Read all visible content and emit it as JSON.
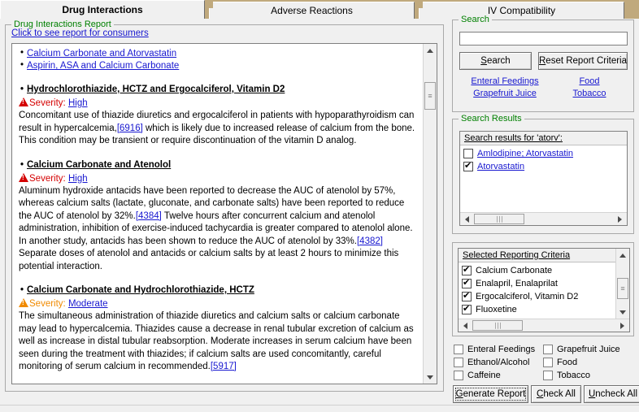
{
  "window": {
    "title": "Drug Interactions"
  },
  "tabs": [
    {
      "label": "Drug Interactions",
      "active": true
    },
    {
      "label": "Adverse Reactions",
      "active": false
    },
    {
      "label": "IV Compatibility",
      "active": false
    }
  ],
  "report_panel": {
    "group_label": "Drug Interactions Report",
    "consumer_link": "Click to see report for consumers",
    "quick_links": [
      "Calcium Carbonate and Atorvastatin",
      "Aspirin, ASA and Calcium Carbonate"
    ],
    "interactions": [
      {
        "title": "Hydrochlorothiazide, HCTZ and Ergocalciferol, Vitamin D2",
        "severity_label": "Severity:",
        "severity_value": "High",
        "severity_level": "high",
        "body_part1": "Concomitant use of thiazide diuretics and ergocalciferol in patients with hypoparathyroidism can result in hypercalcemia,",
        "citation1": "[6916]",
        "body_part2": " which is likely due to increased release of calcium from the bone. This condition may be transient or require discontinuation of the vitamin D analog."
      },
      {
        "title": "Calcium Carbonate and Atenolol",
        "severity_label": "Severity:",
        "severity_value": "High",
        "severity_level": "high",
        "body_part1": "Aluminum hydroxide antacids have been reported to decrease the AUC of atenolol by 57%, whereas calcium salts (lactate, gluconate, and carbonate salts) have been reported to reduce the AUC of atenolol by 32%.",
        "citation1": "[4384]",
        "body_part2": " Twelve hours after concurrent calcium and atenolol administration, inhibition of exercise-induced tachycardia is greater compared to atenolol alone. In another study, antacids has been shown to reduce the AUC of atenolol by 33%.",
        "citation2": "[4382]",
        "body_part3": " Separate doses of atenolol and antacids or calcium salts by at least 2 hours to minimize this potential interaction."
      },
      {
        "title": "Calcium Carbonate and Hydrochlorothiazide, HCTZ",
        "severity_label": "Severity:",
        "severity_value": "Moderate",
        "severity_level": "moderate",
        "body_part1": "The simultaneous administration of thiazide diuretics and calcium salts or calcium carbonate may lead to hypercalcemia. Thiazides cause a decrease in renal tubular excretion of calcium as well as increase in distal tubular reabsorption. Moderate increases in serum calcium have been seen during the treatment with thiazides; if calcium salts are used concomitantly, careful monitoring of serum calcium in recommended.",
        "citation1": "[5917]",
        "body_part2": ""
      }
    ]
  },
  "search_panel": {
    "group_label": "Search",
    "input_value": "",
    "input_placeholder": "",
    "search_button": "Search",
    "search_button_accel": "S",
    "reset_button": "Reset Report Criteria",
    "reset_button_accel": "R",
    "quick_links_row1": [
      "Enteral Feedings",
      "Food"
    ],
    "quick_links_row2": [
      "Grapefruit Juice",
      "Tobacco"
    ]
  },
  "search_results_panel": {
    "group_label": "Search Results",
    "list_header": "Search results for 'atorv':",
    "items": [
      {
        "label": "Amlodipine; Atorvastatin",
        "checked": false
      },
      {
        "label": "Atorvastatin",
        "checked": true
      }
    ]
  },
  "criteria_panel": {
    "list_header": "Selected Reporting Criteria",
    "items": [
      {
        "label": "Calcium Carbonate",
        "checked": true
      },
      {
        "label": "Enalapril, Enalaprilat",
        "checked": true
      },
      {
        "label": "Ergocalciferol, Vitamin D2",
        "checked": true
      },
      {
        "label": "Fluoxetine",
        "checked": true
      }
    ]
  },
  "bottom_checkboxes": [
    {
      "label": "Enteral Feedings",
      "checked": false
    },
    {
      "label": "Grapefruit Juice",
      "checked": false
    },
    {
      "label": "Ethanol/Alcohol",
      "checked": false
    },
    {
      "label": "Food",
      "checked": false
    },
    {
      "label": "Caffeine",
      "checked": false
    },
    {
      "label": "Tobacco",
      "checked": false
    }
  ],
  "bottom_buttons": {
    "generate": "Generate Report",
    "generate_accel": "G",
    "check_all": "Check All",
    "check_all_accel": "C",
    "uncheck_all": "Uncheck All",
    "uncheck_all_accel": "U"
  },
  "colors": {
    "tabstrip": "#c0a97d",
    "group_label": "#008000",
    "link": "#1818d0",
    "severity_high": "#d40000",
    "severity_moderate": "#f08a00",
    "face": "#f0f0f0"
  }
}
